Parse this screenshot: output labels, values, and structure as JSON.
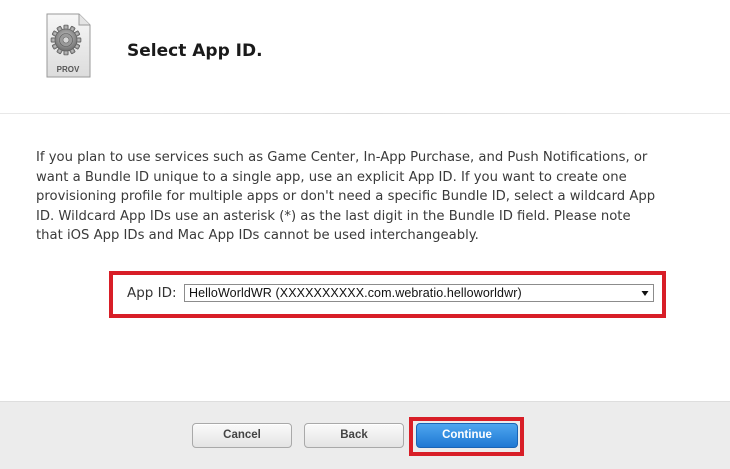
{
  "header": {
    "icon_label": "PROV",
    "title": "Select App ID."
  },
  "description": "If you plan to use services such as Game Center, In-App Purchase, and Push Notifications, or want a Bundle ID unique to a single app, use an explicit App ID. If you want to create one provisioning profile for multiple apps or don't need a specific Bundle ID, select a wildcard App ID. Wildcard App IDs use an asterisk (*) as the last digit in the Bundle ID field. Please note that iOS App IDs and Mac App IDs cannot be used interchangeably.",
  "app_id": {
    "label": "App ID:",
    "selected_value": "HelloWorldWR (XXXXXXXXXX.com.webratio.helloworldwr)"
  },
  "buttons": {
    "cancel": "Cancel",
    "back": "Back",
    "continue": "Continue"
  },
  "colors": {
    "highlight": "#d81e27",
    "primary_button": "#2a86de",
    "footer_background": "#ececec"
  }
}
